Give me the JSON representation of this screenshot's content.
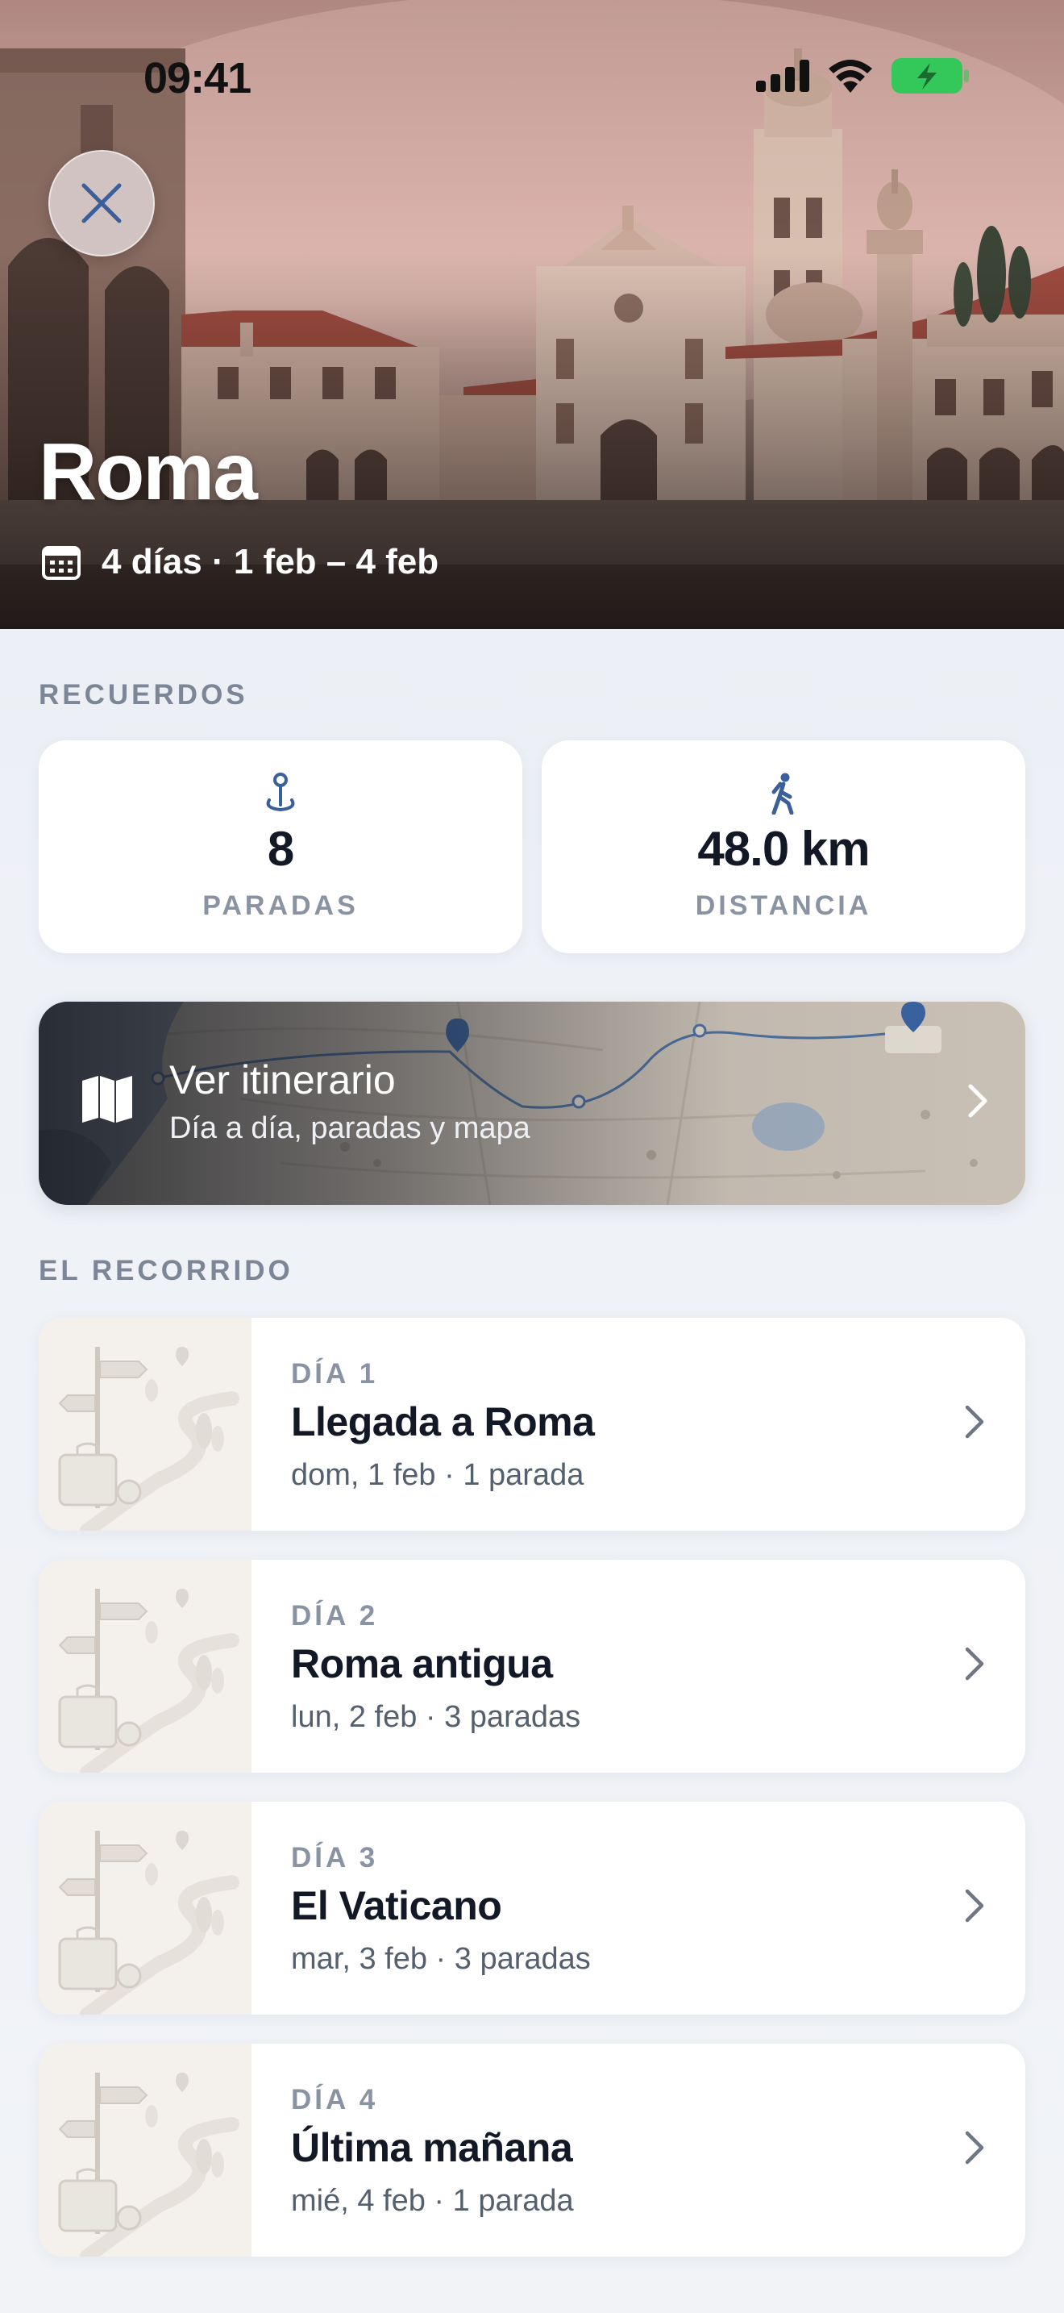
{
  "status_bar": {
    "time": "09:41",
    "icons": [
      "cellular-signal-icon",
      "wifi-icon",
      "battery-charging-icon"
    ]
  },
  "hero": {
    "title": "Roma",
    "subtitle": "4 días · 1 feb – 4 feb",
    "close_icon": "close-icon",
    "calendar_icon": "calendar-icon"
  },
  "memories": {
    "heading": "RECUERDOS",
    "stops": {
      "value": "8",
      "label": "PARADAS",
      "icon": "pin-icon"
    },
    "distance": {
      "value": "48.0 km",
      "label": "DISTANCIA",
      "icon": "walking-icon"
    }
  },
  "itinerary": {
    "title": "Ver itinerario",
    "subtitle": "Día a día, paradas y mapa",
    "icon": "map-icon"
  },
  "route": {
    "heading": "EL RECORRIDO",
    "days": [
      {
        "kicker": "DÍA 1",
        "title": "Llegada a Roma",
        "meta": "dom, 1 feb · 1 parada"
      },
      {
        "kicker": "DÍA 2",
        "title": "Roma antigua",
        "meta": "lun, 2 feb · 3 paradas"
      },
      {
        "kicker": "DÍA 3",
        "title": "El Vaticano",
        "meta": "mar, 3 feb · 3 paradas"
      },
      {
        "kicker": "DÍA 4",
        "title": "Última mañana",
        "meta": "mié, 4 feb · 1 parada"
      }
    ]
  },
  "colors": {
    "accent": "#3a5f9a",
    "battery": "#34c759",
    "background": "#eef1f6"
  }
}
